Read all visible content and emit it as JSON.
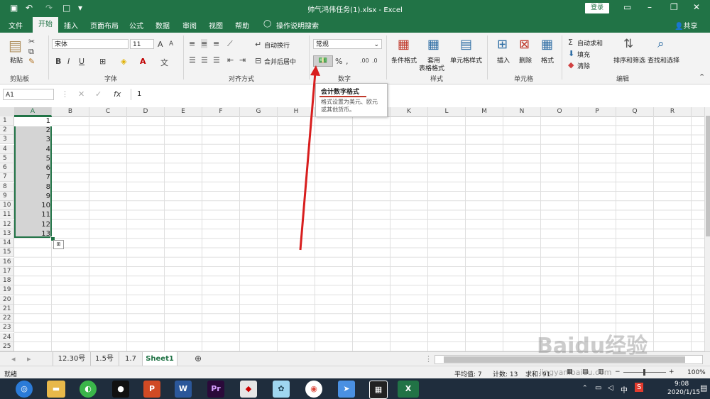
{
  "titlebar": {
    "title": "帅气鸿伟任务(1).xlsx  -  Excel",
    "login": "登录"
  },
  "tabs": [
    "文件",
    "开始",
    "插入",
    "页面布局",
    "公式",
    "数据",
    "审阅",
    "视图",
    "帮助"
  ],
  "tell_me": "操作说明搜索",
  "share": "共享",
  "ribbon": {
    "clipboard": {
      "paste": "粘贴",
      "group": "剪贴板"
    },
    "font": {
      "name": "宋体",
      "size": "11",
      "group": "字体",
      "bold": "B",
      "italic": "I",
      "underline": "U"
    },
    "alignment": {
      "wrap": "自动换行",
      "merge": "合并后居中",
      "group": "对齐方式"
    },
    "number": {
      "format": "常规",
      "group": "数字",
      "percent": "%"
    },
    "styles": {
      "conditional": "条件格式",
      "table1": "套用",
      "table2": "表格格式",
      "cell_styles": "单元格样式",
      "group": "样式"
    },
    "cells": {
      "insert": "插入",
      "delete": "删除",
      "format": "格式",
      "group": "单元格"
    },
    "editing": {
      "autosum": "自动求和",
      "fill": "填充",
      "clear": "清除",
      "sort": "排序和筛选",
      "find": "查找和选择",
      "group": "编辑"
    }
  },
  "formula": {
    "namebox": "A1",
    "fx": "fx",
    "value": "1"
  },
  "columns": [
    "A",
    "B",
    "C",
    "D",
    "E",
    "F",
    "G",
    "H",
    "I",
    "J",
    "K",
    "L",
    "M",
    "N",
    "O",
    "P",
    "Q",
    "R"
  ],
  "rows": [
    "1",
    "2",
    "3",
    "4",
    "5",
    "6",
    "7",
    "8",
    "9",
    "10",
    "11",
    "12",
    "13",
    "14",
    "15",
    "16",
    "17",
    "18",
    "19",
    "20",
    "21",
    "22",
    "23",
    "24",
    "25"
  ],
  "cells_A": [
    "1",
    "2",
    "3",
    "4",
    "5",
    "6",
    "7",
    "8",
    "9",
    "10",
    "11",
    "12",
    "13"
  ],
  "tooltip": {
    "title": "会计数字格式",
    "desc1": "格式设置为美元、欧元",
    "desc2": "或其他货币。"
  },
  "sheets": [
    "12.30号",
    "1.5号",
    "1.7",
    "Sheet1"
  ],
  "status": {
    "mode": "就绪",
    "average": "平均值: 7",
    "count": "计数: 13",
    "sum": "求和: 91",
    "zoom": "100%"
  },
  "clock": {
    "time": "9:08",
    "date": "2020/1/15"
  },
  "watermark": "Baidu经验",
  "watermark_url": "jingyan.baidu.com",
  "colors": {
    "excel_green": "#217346",
    "arrow": "#d81e1e"
  }
}
